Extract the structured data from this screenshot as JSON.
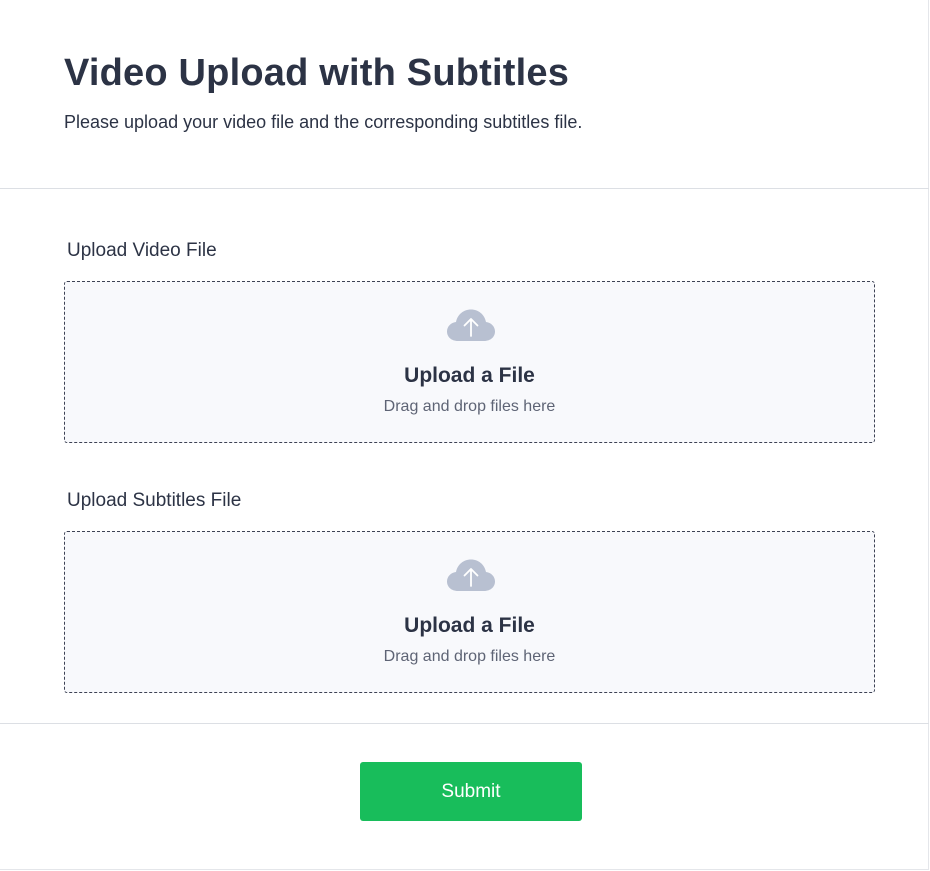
{
  "form": {
    "title": "Video Upload with Subtitles",
    "description": "Please upload your video file and the corresponding subtitles file."
  },
  "fields": [
    {
      "label": "Upload Video File",
      "dropzone": {
        "icon": "cloud-upload-icon",
        "title": "Upload a File",
        "hint": "Drag and drop files here"
      }
    },
    {
      "label": "Upload Subtitles File",
      "dropzone": {
        "icon": "cloud-upload-icon",
        "title": "Upload a File",
        "hint": "Drag and drop files here"
      }
    }
  ],
  "submit": {
    "label": "Submit"
  },
  "colors": {
    "primary_text": "#2c3345",
    "muted_text": "#5e6475",
    "icon": "#b8c0d1",
    "dropzone_bg": "#f8f9fc",
    "submit_bg": "#18bd5b",
    "divider": "#dcdfe4"
  }
}
